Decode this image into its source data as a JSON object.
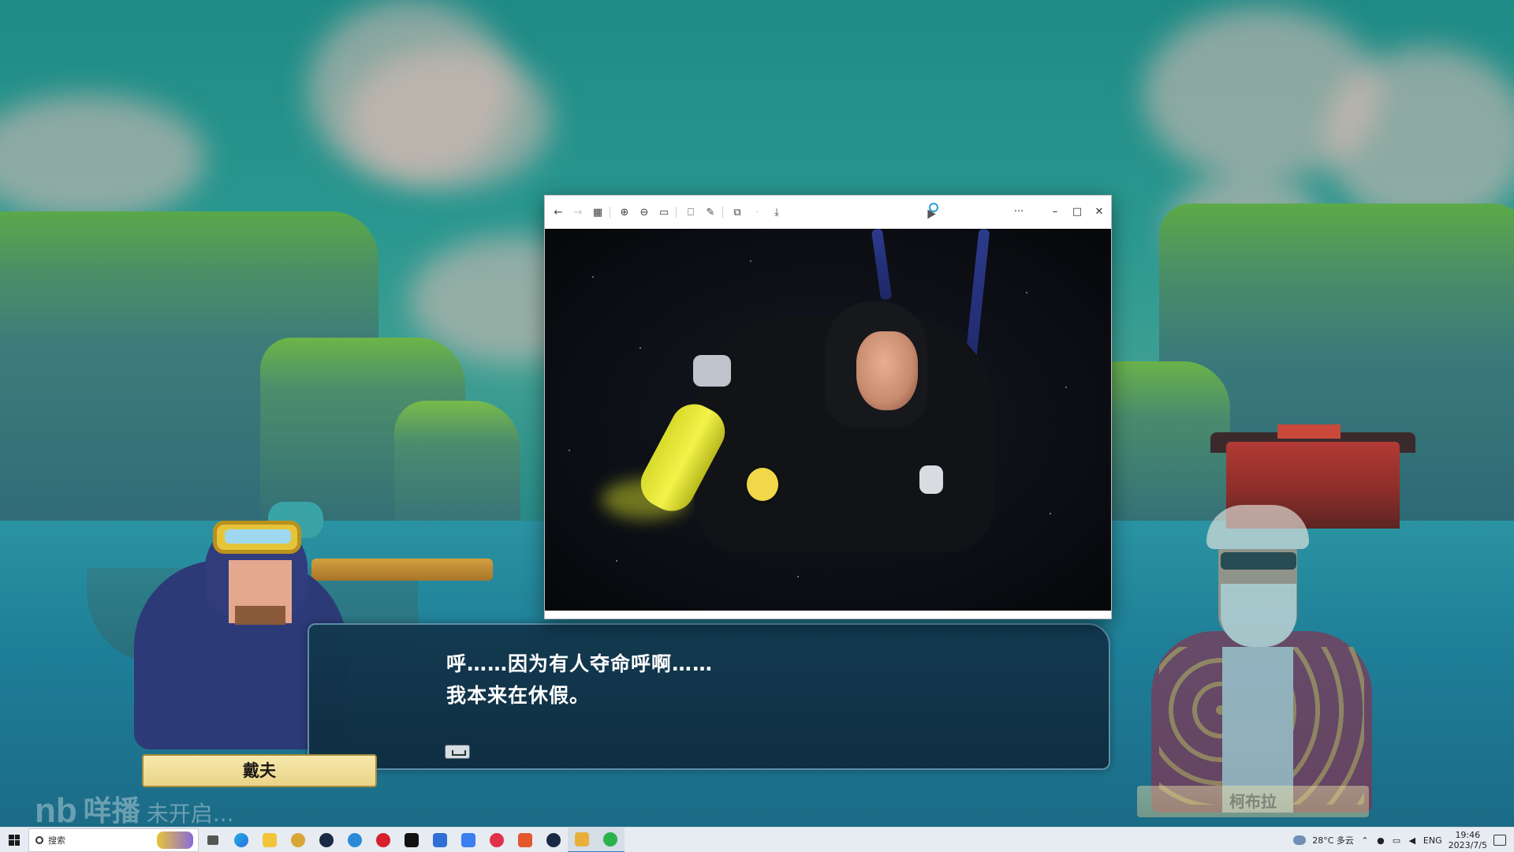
{
  "game": {
    "dialogue": {
      "line1": "呼……因为有人夺命呼啊……",
      "line2": "我本来在休假。"
    },
    "speaker_name": "戴夫",
    "other_name": "柯布拉",
    "watermark": {
      "logo": "nb",
      "brand": "咩播",
      "status": "未开启..."
    }
  },
  "viewer": {
    "toolbar_icons": [
      "back-icon",
      "forward-icon",
      "gallery-icon",
      "zoom-in-icon",
      "zoom-out-icon",
      "fit-icon",
      "rotate-icon",
      "edit-icon",
      "crop-icon",
      "delete-icon",
      "save-icon"
    ],
    "more_label": "···",
    "minimize_label": "–",
    "maximize_label": "□",
    "close_label": "✕"
  },
  "taskbar": {
    "search_placeholder": "搜索",
    "apps": [
      "task-view",
      "edge",
      "file-explorer",
      "game-app",
      "steam",
      "app-blue",
      "netease-music",
      "capcut",
      "app-k",
      "app-feishu",
      "app-record",
      "app-red",
      "steam-2",
      "app-yellow",
      "wechat"
    ],
    "weather": "28°C 多云",
    "language": "ENG",
    "time": "19:46",
    "date": "2023/7/5"
  },
  "colors": {
    "dialogue_bg": "#12384e",
    "name_plate": "#f2e19c",
    "taskbar_bg": "#e7ecf2"
  }
}
